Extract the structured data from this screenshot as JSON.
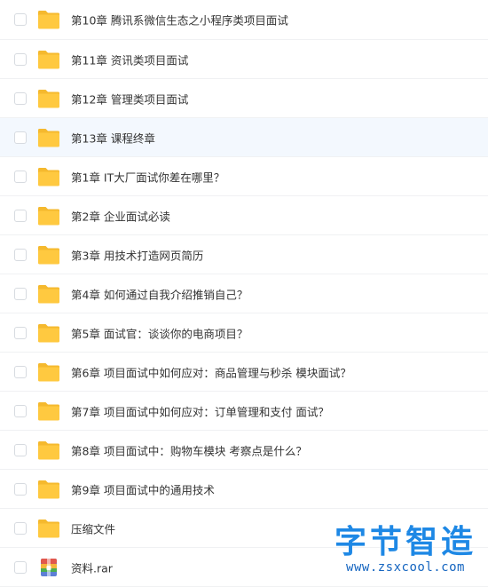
{
  "files": [
    {
      "name": "第10章 腾讯系微信生态之小程序类项目面试",
      "type": "folder"
    },
    {
      "name": "第11章 资讯类项目面试",
      "type": "folder"
    },
    {
      "name": "第12章 管理类项目面试",
      "type": "folder"
    },
    {
      "name": "第13章 课程终章",
      "type": "folder",
      "hovered": true
    },
    {
      "name": "第1章 IT大厂面试你差在哪里？",
      "type": "folder"
    },
    {
      "name": "第2章 企业面试必读",
      "type": "folder"
    },
    {
      "name": "第3章 用技术打造网页简历",
      "type": "folder"
    },
    {
      "name": "第4章 如何通过自我介绍推销自己？",
      "type": "folder"
    },
    {
      "name": "第5章 面试官：谈谈你的电商项目？",
      "type": "folder"
    },
    {
      "name": "第6章 项目面试中如何应对：商品管理与秒杀 模块面试？",
      "type": "folder"
    },
    {
      "name": "第7章 项目面试中如何应对：订单管理和支付 面试？",
      "type": "folder"
    },
    {
      "name": "第8章 项目面试中：购物车模块 考察点是什么？",
      "type": "folder"
    },
    {
      "name": "第9章 项目面试中的通用技术",
      "type": "folder"
    },
    {
      "name": "压缩文件",
      "type": "folder"
    },
    {
      "name": "资料.rar",
      "type": "archive"
    }
  ],
  "icons": {
    "folder": "folder-icon",
    "archive": "archive-icon"
  },
  "colors": {
    "folder": "#ffc940",
    "folder_tab": "#f5b92e",
    "hover_row": "#f3f8fe",
    "text": "#333333",
    "watermark": "#1e88e5"
  },
  "watermark": {
    "title": "字节智造",
    "url": "www.zsxcool.com"
  }
}
